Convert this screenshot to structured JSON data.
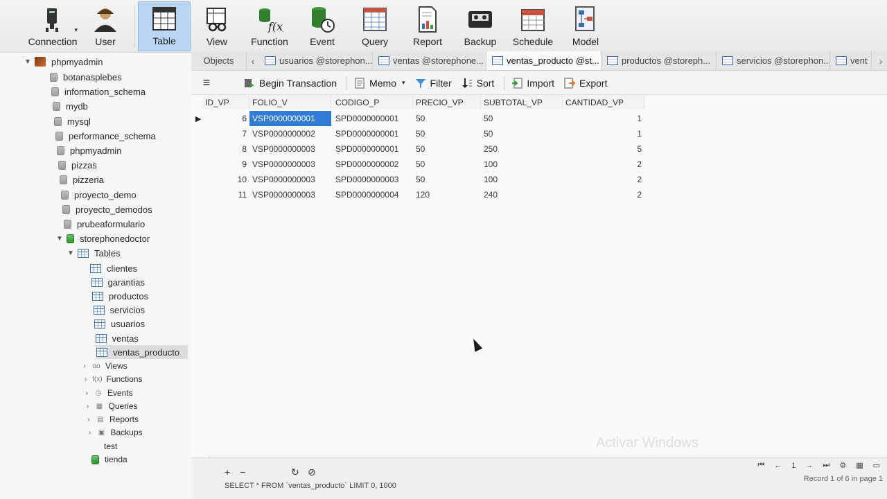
{
  "toolbar": {
    "buttons": [
      {
        "label": "Connection",
        "icon": "connection-icon"
      },
      {
        "label": "User",
        "icon": "user-icon"
      },
      {
        "label": "Table",
        "icon": "table-icon",
        "active": true
      },
      {
        "label": "View",
        "icon": "view-icon"
      },
      {
        "label": "Function",
        "icon": "function-icon"
      },
      {
        "label": "Event",
        "icon": "event-icon"
      },
      {
        "label": "Query",
        "icon": "query-icon"
      },
      {
        "label": "Report",
        "icon": "report-icon"
      },
      {
        "label": "Backup",
        "icon": "backup-icon"
      },
      {
        "label": "Schedule",
        "icon": "schedule-icon"
      },
      {
        "label": "Model",
        "icon": "model-icon"
      }
    ]
  },
  "sidebar": {
    "connection": "phpmyadmin",
    "databases": [
      "botanasplebes",
      "information_schema",
      "mydb",
      "mysql",
      "performance_schema",
      "phpmyadmin",
      "pizzas",
      "pizzeria",
      "proyecto_demo",
      "proyecto_demodos",
      "prubeaformulario"
    ],
    "open_database": "storephonedoctor",
    "tables_label": "Tables",
    "tables": [
      "clientes",
      "garantias",
      "productos",
      "servicios",
      "usuarios",
      "ventas",
      "ventas_producto"
    ],
    "groups": [
      "Views",
      "Functions",
      "Events",
      "Queries",
      "Reports",
      "Backups"
    ],
    "after": [
      "test",
      "tienda"
    ]
  },
  "tabs": {
    "objects": "Objects",
    "items": [
      "usuarios @storephon...",
      "ventas @storephone...",
      "ventas_producto @st...",
      "productos @storeph...",
      "servicios @storephon...",
      "vent"
    ],
    "active_index": 2
  },
  "subtoolbar": {
    "begin_transaction": "Begin Transaction",
    "memo": "Memo",
    "filter": "Filter",
    "sort": "Sort",
    "import": "Import",
    "export": "Export"
  },
  "grid": {
    "columns": [
      "ID_VP",
      "FOLIO_V",
      "CODIGO_P",
      "PRECIO_VP",
      "SUBTOTAL_VP",
      "CANTIDAD_VP"
    ],
    "rows": [
      [
        "6",
        "VSP0000000001",
        "SPD0000000001",
        "50",
        "50",
        "1"
      ],
      [
        "7",
        "VSP0000000002",
        "SPD0000000001",
        "50",
        "50",
        "1"
      ],
      [
        "8",
        "VSP0000000003",
        "SPD0000000001",
        "50",
        "250",
        "5"
      ],
      [
        "9",
        "VSP0000000003",
        "SPD0000000002",
        "50",
        "100",
        "2"
      ],
      [
        "10",
        "VSP0000000003",
        "SPD0000000003",
        "50",
        "100",
        "2"
      ],
      [
        "11",
        "VSP0000000003",
        "SPD0000000004",
        "120",
        "240",
        "2"
      ]
    ],
    "selected_row": 0,
    "selected_col": 1
  },
  "bottombar": {
    "sql": "SELECT * FROM `ventas_producto` LIMIT 0, 1000",
    "page": "1",
    "record_info": "Record 1 of 6 in page 1"
  },
  "watermark": "Activar Windows"
}
